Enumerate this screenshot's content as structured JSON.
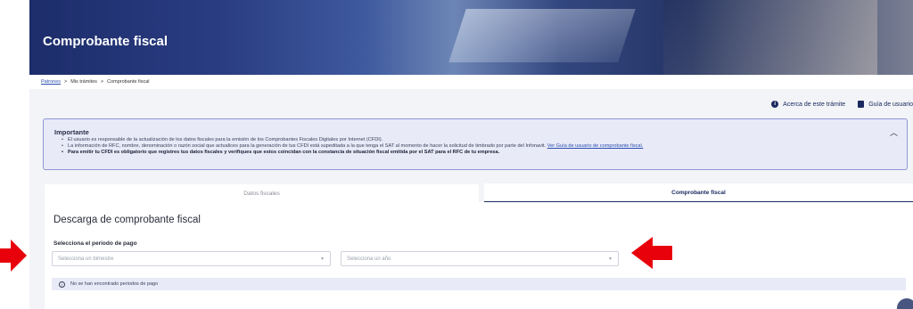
{
  "hero": {
    "title": "Comprobante fiscal"
  },
  "breadcrumb": {
    "items": [
      "Patrones",
      "Mis trámites",
      "Comprobante fiscal"
    ],
    "separator": ">"
  },
  "top_links": {
    "about": "Acerca de este trámite",
    "guide": "Guía de usuario"
  },
  "notice": {
    "title": "Importante",
    "items": [
      "El usuario es responsable de la actualización de los datos fiscales para la emisión de los Comprobantes Fiscales Digitales por Internet (CFDI).",
      "La información de RFC, nombre, denominación o razón social que actualices para la generación de tus CFDI está supeditada a la que tenga el SAT al momento de hacer la solicitud de timbrado por parte del Infonavit.",
      "Para emitir tu CFDI es obligatorio que registres tus datos fiscales y verifiques que estos coincidan con la constancia de situación fiscal emitida por el SAT para el RFC de tu empresa."
    ],
    "link": "Ver Guía de usuario de comprobante fiscal."
  },
  "tabs": [
    {
      "label": "Datos fiscales",
      "active": false
    },
    {
      "label": "Comprobante fiscal",
      "active": true
    }
  ],
  "card": {
    "title": "Descarga de comprobante fiscal",
    "field_label": "Selecciona el periodo de pago",
    "bimestre_placeholder": "Selecciona un bimestre",
    "anio_placeholder": "Selecciona un año",
    "empty_message": "No se han encontrado periodos de pago"
  },
  "colors": {
    "accent": "#1a2a60",
    "notice_bg": "#e8eaf8",
    "arrow": "#e8000b"
  }
}
